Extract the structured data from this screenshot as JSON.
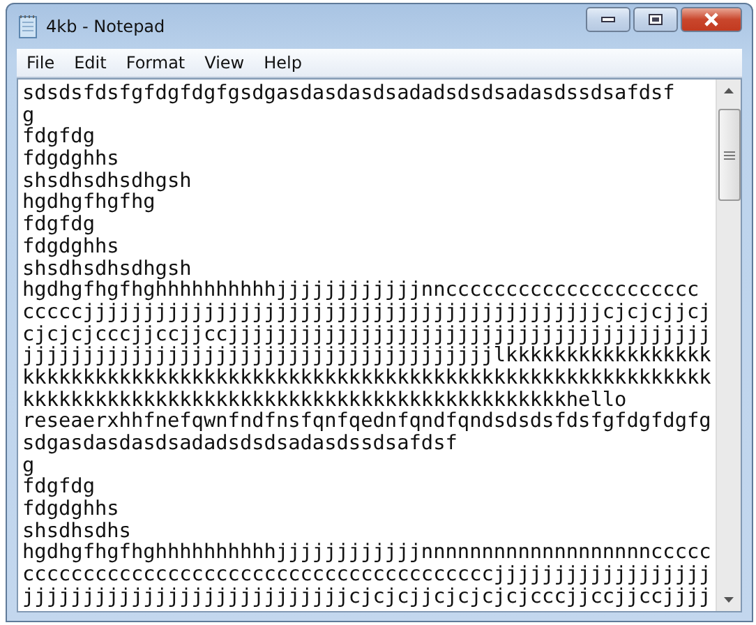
{
  "window": {
    "title": "4kb - Notepad"
  },
  "menu": [
    "File",
    "Edit",
    "Format",
    "View",
    "Help"
  ],
  "editor": {
    "lines": [
      "sdsdsfdsfgfdgfdgfgsdgasdasdasdsadadsdsdsadasdssdsafdsf",
      "g",
      "fdgfdg",
      "fdgdghhs",
      "shsdhsdhsdhgsh",
      "hgdhgfhgfhg",
      "fdgfdg",
      "fdgdghhs",
      "shsdhsdhsdhgsh",
      "hgdhgfhgfhghhhhhhhhhhjjjjjjjjjjjjnnccccccccccccccccccccc",
      "cccccjjjjjjjjjjjjjjjjjjjjjjjjjjjjjjjjjjjjjjjjjjjcjcjcjjcj",
      "cjcjcjcccjjccjjccjjjjjjjjjjjjjjjjjjjjjjjjjjjjjjjjjjjjjjjj",
      "jjjjjjjjjjjjjjjjjjjjjjjjjjjjjjjjjjjjjjjlkkkkkkkkkkkkkkkkk",
      "kkkkkkkkkkkkkkkkkkkkkkkkkkkkkkkkkkkkkkkkkkkkkkkkkkkkkkkkk",
      "kkkkkkkkkkkkkkkkkkkkkkkkkkkkkkkkkkkkkkkkkkkkkhello",
      "reseaerxhhfnefqwnfndfnsfqnfqednfqndfqndsdsdsfdsfgfdgfdgfg",
      "sdgasdasdasdsadadsdsdsadasdssdsafdsf",
      "g",
      "fdgfdg",
      "fdgdghhs",
      "shsdhsdhs",
      "hgdhgfhgfhghhhhhhhhhhjjjjjjjjjjjjnnnnnnnnnnnnnnnnnnnccccc",
      "cccccccccccccccccccccccccccccccccccccccjjjjjjjjjjjjjjjjjj",
      "jjjjjjjjjjjjjjjjjjjjjjjjjjjcjcjcjjcjcjcjcjcccjjccjjccjjjj"
    ]
  }
}
